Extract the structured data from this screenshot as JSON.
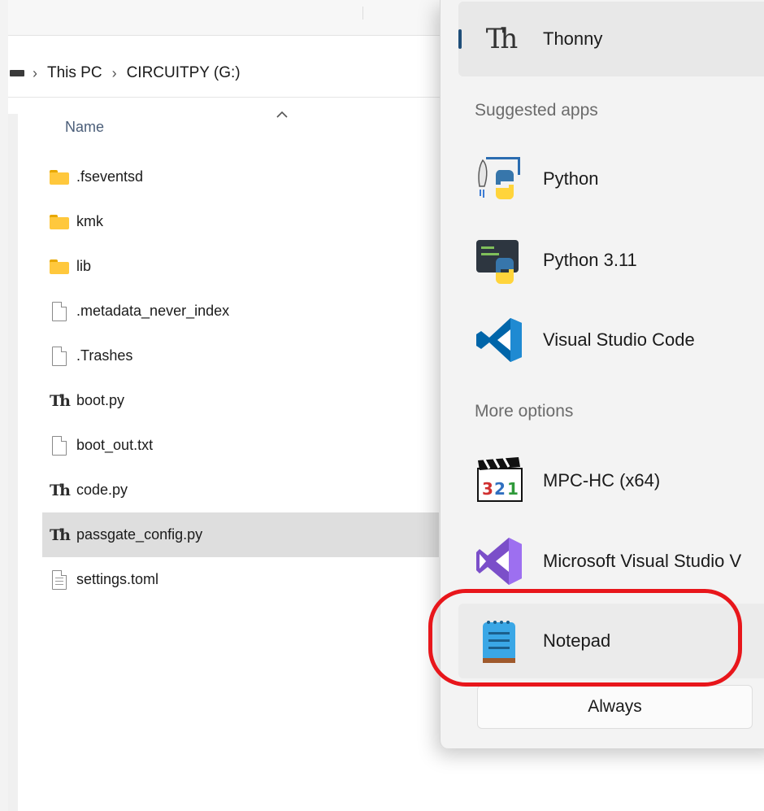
{
  "explorer": {
    "breadcrumb": [
      "This PC",
      "CIRCUITPY (G:)"
    ],
    "column_header": "Name",
    "files": [
      {
        "name": ".fseventsd",
        "icon": "folder-icon",
        "selected": false
      },
      {
        "name": "kmk",
        "icon": "folder-icon",
        "selected": false
      },
      {
        "name": "lib",
        "icon": "folder-icon",
        "selected": false
      },
      {
        "name": ".metadata_never_index",
        "icon": "file-icon",
        "selected": false
      },
      {
        "name": ".Trashes",
        "icon": "file-icon",
        "selected": false
      },
      {
        "name": "boot.py",
        "icon": "thonny-file-icon",
        "selected": false
      },
      {
        "name": "boot_out.txt",
        "icon": "file-icon",
        "selected": false
      },
      {
        "name": "code.py",
        "icon": "thonny-file-icon",
        "selected": false
      },
      {
        "name": "passgate_config.py",
        "icon": "thonny-file-icon",
        "selected": true
      },
      {
        "name": "settings.toml",
        "icon": "text-file-icon",
        "selected": false
      }
    ]
  },
  "open_with": {
    "current_app": {
      "label": "Thonny",
      "icon": "thonny-icon"
    },
    "suggested_label": "Suggested apps",
    "suggested": [
      {
        "label": "Python",
        "icon": "python-icon"
      },
      {
        "label": "Python 3.11",
        "icon": "python-311-icon"
      },
      {
        "label": "Visual Studio Code",
        "icon": "vscode-icon"
      }
    ],
    "more_label": "More options",
    "more": [
      {
        "label": "MPC-HC (x64)",
        "icon": "mpc-hc-icon"
      },
      {
        "label": "Microsoft Visual Studio V",
        "icon": "visual-studio-icon"
      },
      {
        "label": "Notepad",
        "icon": "notepad-icon"
      }
    ],
    "always_button": "Always"
  },
  "colors": {
    "highlight": "#e8161b",
    "selection": "#dedede",
    "folder": "#ffc83d",
    "accent_bar": "#1f4e79"
  }
}
